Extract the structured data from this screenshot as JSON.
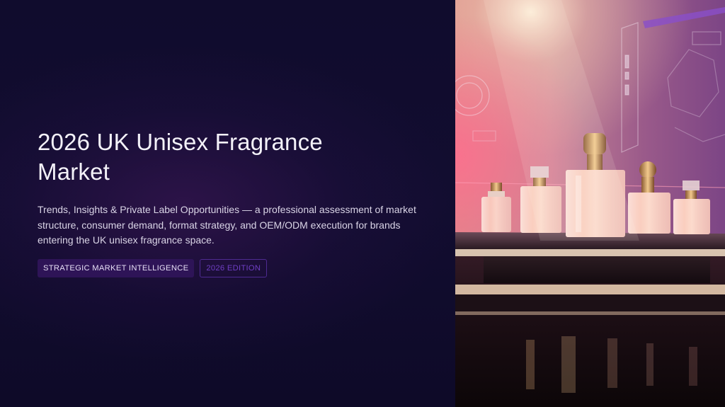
{
  "slide": {
    "title": "2026 UK Unisex Fragrance Market",
    "subtitle": "Trends, Insights & Private Label Opportunities — a professional assessment of market structure, consumer demand, format strategy, and OEM/ODM execution for brands entering the UK unisex fragrance space.",
    "tags": {
      "primary": "STRATEGIC MARKET INTELLIGENCE",
      "secondary": "2026 EDITION"
    }
  },
  "colors": {
    "background": "#0f0b2a",
    "title_text": "#f3f1f8",
    "body_text": "#d9d4e6",
    "tag_primary_bg": "#2e1457",
    "tag_secondary_text": "#6f3ec4",
    "accent_pink": "#e07a9a",
    "accent_gold": "#f0c890"
  },
  "image": {
    "subject": "perfume bottles on illuminated display pedestal"
  }
}
